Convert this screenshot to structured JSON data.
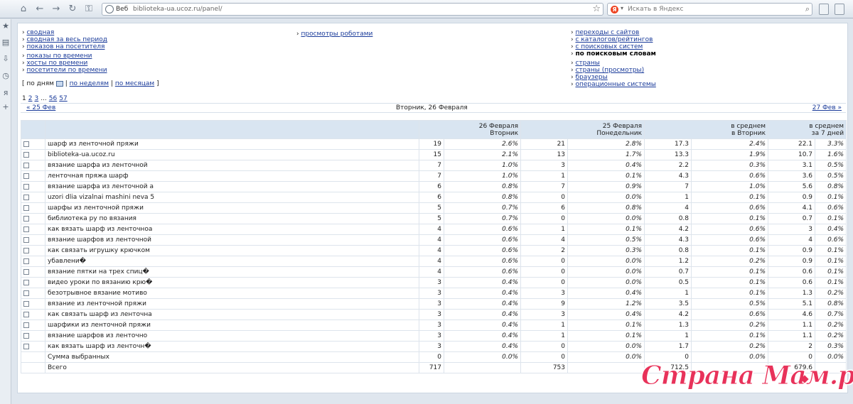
{
  "browser": {
    "url_label": "Веб",
    "url": "biblioteka-ua.ucoz.ru/panel/",
    "search_placeholder": "Искать в Яндекс",
    "ya_letter": "Я"
  },
  "nav": {
    "col1_a": [
      "сводная",
      "сводная за весь период",
      "показов на посетителя"
    ],
    "col1_b": [
      "показы по времени",
      "хосты по времени",
      "посетители по времени"
    ],
    "col2": [
      "просмотры роботами"
    ],
    "col3_a": [
      "переходы с сайтов",
      "с каталогов/рейтингов",
      "с поисковых систем"
    ],
    "col3_current": "по поисковым словам",
    "col3_b": [
      "страны",
      "страны (просмотры)",
      "браузеры",
      "операционные системы"
    ]
  },
  "filter": {
    "open": "[",
    "by_day": "по дням",
    "sep": "|",
    "by_week": "по неделям",
    "by_month": "по месяцам",
    "close": "]"
  },
  "pagination": {
    "pages": [
      "1",
      "2",
      "3"
    ],
    "ellipsis": "...",
    "tail": [
      "56",
      "57"
    ]
  },
  "dates": {
    "prev": "« 25 Фев",
    "current": "Вторник, 26 Февраля",
    "next": "27 Фев »"
  },
  "table": {
    "headers": [
      {
        "l1": "26 Февраля",
        "l2": "Вторник"
      },
      {
        "l1": "25 Февраля",
        "l2": "Понедельник"
      },
      {
        "l1": "в среднем",
        "l2": "в Вторник"
      },
      {
        "l1": "в среднем",
        "l2": "за 7 дней"
      }
    ],
    "rows": [
      [
        "шарф из ленточной пряжи",
        "19",
        "2.6%",
        "21",
        "2.8%",
        "17.3",
        "2.4%",
        "22.1",
        "3.3%"
      ],
      [
        "biblioteka-ua.ucoz.ru",
        "15",
        "2.1%",
        "13",
        "1.7%",
        "13.3",
        "1.9%",
        "10.7",
        "1.6%"
      ],
      [
        "вязание шарфа из ленточной",
        "7",
        "1.0%",
        "3",
        "0.4%",
        "2.2",
        "0.3%",
        "3.1",
        "0.5%"
      ],
      [
        "ленточная пряжа шарф",
        "7",
        "1.0%",
        "1",
        "0.1%",
        "4.3",
        "0.6%",
        "3.6",
        "0.5%"
      ],
      [
        "вязание шарфа из ленточной а",
        "6",
        "0.8%",
        "7",
        "0.9%",
        "7",
        "1.0%",
        "5.6",
        "0.8%"
      ],
      [
        "uzori dlia vizalnai mashini neva 5",
        "6",
        "0.8%",
        "0",
        "0.0%",
        "1",
        "0.1%",
        "0.9",
        "0.1%"
      ],
      [
        "шарфы из ленточной пряжи",
        "5",
        "0.7%",
        "6",
        "0.8%",
        "4",
        "0.6%",
        "4.1",
        "0.6%"
      ],
      [
        "библиотека ру по вязания",
        "5",
        "0.7%",
        "0",
        "0.0%",
        "0.8",
        "0.1%",
        "0.7",
        "0.1%"
      ],
      [
        "как вязать шарф из ленточноа",
        "4",
        "0.6%",
        "1",
        "0.1%",
        "4.2",
        "0.6%",
        "3",
        "0.4%"
      ],
      [
        "вязание шарфов из ленточной",
        "4",
        "0.6%",
        "4",
        "0.5%",
        "4.3",
        "0.6%",
        "4",
        "0.6%"
      ],
      [
        "как связать игрушку крючком",
        "4",
        "0.6%",
        "2",
        "0.3%",
        "0.8",
        "0.1%",
        "0.9",
        "0.1%"
      ],
      [
        "убавлени�",
        "4",
        "0.6%",
        "0",
        "0.0%",
        "1.2",
        "0.2%",
        "0.9",
        "0.1%"
      ],
      [
        "вязание пятки на трех спиц�",
        "4",
        "0.6%",
        "0",
        "0.0%",
        "0.7",
        "0.1%",
        "0.6",
        "0.1%"
      ],
      [
        "видео уроки по вязанию крю�",
        "3",
        "0.4%",
        "0",
        "0.0%",
        "0.5",
        "0.1%",
        "0.6",
        "0.1%"
      ],
      [
        "безотрывное вязание мотиво",
        "3",
        "0.4%",
        "3",
        "0.4%",
        "1",
        "0.1%",
        "1.3",
        "0.2%"
      ],
      [
        "вязание из ленточной пряжи",
        "3",
        "0.4%",
        "9",
        "1.2%",
        "3.5",
        "0.5%",
        "5.1",
        "0.8%"
      ],
      [
        "как связать шарф из ленточна",
        "3",
        "0.4%",
        "3",
        "0.4%",
        "4.2",
        "0.6%",
        "4.6",
        "0.7%"
      ],
      [
        "шарфики из ленточной пряжи",
        "3",
        "0.4%",
        "1",
        "0.1%",
        "1.3",
        "0.2%",
        "1.1",
        "0.2%"
      ],
      [
        "вязание шарфов из ленточно",
        "3",
        "0.4%",
        "1",
        "0.1%",
        "1",
        "0.1%",
        "1.1",
        "0.2%"
      ],
      [
        "как вязать шарф из ленточн�",
        "3",
        "0.4%",
        "0",
        "0.0%",
        "1.7",
        "0.2%",
        "2",
        "0.3%"
      ]
    ],
    "sum_row": [
      "Сумма выбранных",
      "0",
      "0.0%",
      "0",
      "0.0%",
      "0",
      "0.0%",
      "0",
      "0.0%"
    ],
    "total_row": [
      "Всего",
      "717",
      "",
      "753",
      "",
      "712.5",
      "",
      "679.6",
      ""
    ]
  },
  "watermark": "Страна Мам.ру"
}
